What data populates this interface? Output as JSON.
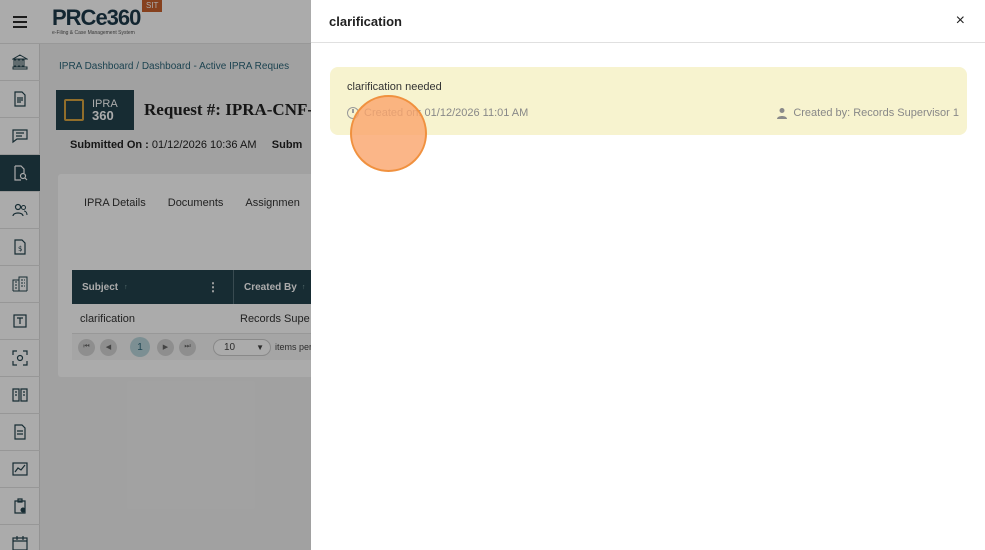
{
  "header": {
    "logo_text": "PRCe360",
    "logo_tagline": "e-Filing & Case Management System",
    "env_badge": "SIT"
  },
  "sidebar": {
    "items": [
      {
        "icon": "bank-icon"
      },
      {
        "icon": "document-icon"
      },
      {
        "icon": "chat-icon"
      },
      {
        "icon": "document-search-icon",
        "active": true
      },
      {
        "icon": "users-icon"
      },
      {
        "icon": "invoice-icon"
      },
      {
        "icon": "building-icon"
      },
      {
        "icon": "template-icon"
      },
      {
        "icon": "scan-icon"
      },
      {
        "icon": "book-icon"
      },
      {
        "icon": "file-icon"
      },
      {
        "icon": "chart-icon"
      },
      {
        "icon": "clipboard-icon"
      },
      {
        "icon": "calendar-icon"
      }
    ]
  },
  "main": {
    "breadcrumb": "IPRA Dashboard / Dashboard - Active IPRA Reques",
    "badge_line1": "IPRA",
    "badge_line2": "360",
    "request_title": "Request #: IPRA-CNF-oo",
    "submitted_label": "Submitted On :",
    "submitted_value": "01/12/2026 10:36 AM",
    "submitted_extra": "Subm",
    "tabs": [
      "IPRA Details",
      "Documents",
      "Assignmen"
    ],
    "grid": {
      "col_subject": "Subject",
      "col_created_by": "Created By",
      "row_subject": "clarification",
      "row_created_by": "Records Supe",
      "page": "1",
      "page_size": "10",
      "page_size_label": "items per p"
    }
  },
  "drawer": {
    "title": "clarification",
    "close": "×",
    "note": {
      "text": "clarification needed",
      "created_on": "Created on: 01/12/2026 11:01 AM",
      "created_by": "Created by: Records Supervisor 1"
    }
  },
  "colors": {
    "primary": "#23424d",
    "note_bg": "#f7f3cf",
    "accent": "#c8622d"
  }
}
